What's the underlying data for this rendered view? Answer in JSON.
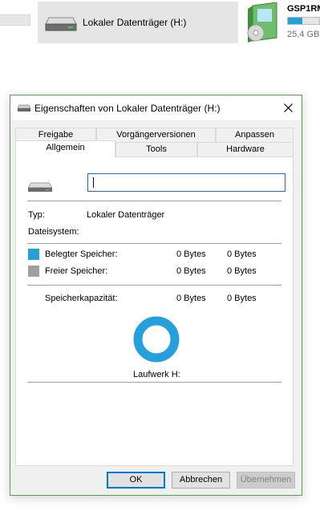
{
  "background": {
    "drive_tile_label": "Lokaler Datenträger (H:)",
    "app_title": "GSP1RM",
    "app_size": "25,4 GB",
    "app_usage_fraction": 0.45
  },
  "dialog": {
    "title": "Eigenschaften von Lokaler Datenträger (H:)",
    "tabs_row1": [
      "Freigabe",
      "Vorgängerversionen",
      "Anpassen"
    ],
    "tabs_row2": [
      "Allgemein",
      "Tools",
      "Hardware"
    ],
    "active_tab": "Allgemein",
    "name_value": "",
    "type_label": "Typ:",
    "type_value": "Lokaler Datenträger",
    "fs_label": "Dateisystem:",
    "fs_value": "",
    "used_label": "Belegter Speicher:",
    "used_bytes": "0 Bytes",
    "used_size": "0 Bytes",
    "free_label": "Freier Speicher:",
    "free_bytes": "0 Bytes",
    "free_size": "0 Bytes",
    "capacity_label": "Speicherkapazität:",
    "capacity_bytes": "0 Bytes",
    "capacity_size": "0 Bytes",
    "drive_label": "Laufwerk H:",
    "used_color": "#26a0da",
    "free_color": "#a0a0a0",
    "buttons": {
      "ok": "OK",
      "cancel": "Abbrechen",
      "apply": "Übernehmen"
    }
  }
}
